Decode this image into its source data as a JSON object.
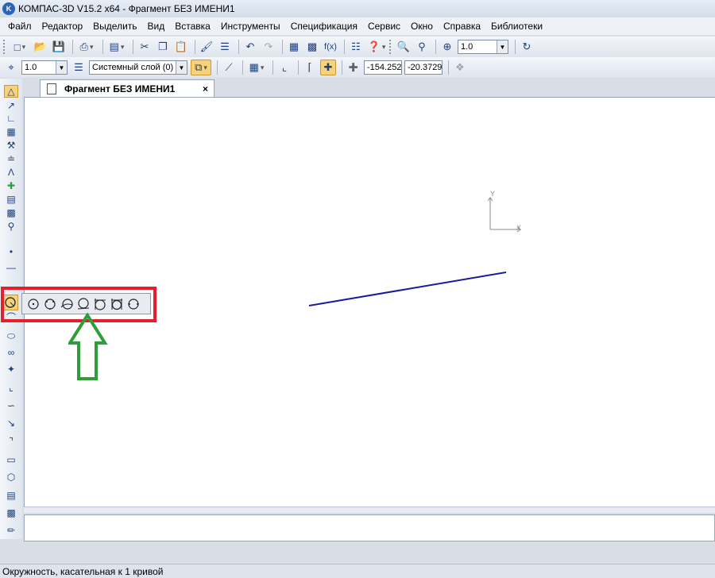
{
  "window": {
    "title": "КОМПАС-3D V15.2  x64 - Фрагмент БЕЗ ИМЕНИ1",
    "app_icon_text": "K"
  },
  "menu": [
    "Файл",
    "Редактор",
    "Выделить",
    "Вид",
    "Вставка",
    "Инструменты",
    "Спецификация",
    "Сервис",
    "Окно",
    "Справка",
    "Библиотеки"
  ],
  "toolbar_standard": {
    "zoom_value": "1.0",
    "fx_label": "f(x)"
  },
  "toolbar_current_state": {
    "step_value": "1.0",
    "layer": "Системный слой (0)",
    "coord_x": "-154.252",
    "coord_y": "-20.3729"
  },
  "document_tab": {
    "label": "Фрагмент БЕЗ ИМЕНИ1",
    "close": "×"
  },
  "canvas": {
    "axis_y_label": "Y",
    "axis_x_label": "X",
    "line_color": "#1a1aa0"
  },
  "flyout": {
    "tools": [
      "circle-center-radius-icon",
      "circle-3-points-icon",
      "circle-with-center-on-object-icon",
      "circle-tangent-1-curve-icon",
      "circle-tangent-2-curves-icon",
      "circle-tangent-3-curves-icon",
      "circle-2-points-icon"
    ]
  },
  "annotation": {
    "frame_color": "#e5202c",
    "arrow_color": "#2e9e3a"
  },
  "status": {
    "text": "Окружность, касательная к 1 кривой"
  }
}
